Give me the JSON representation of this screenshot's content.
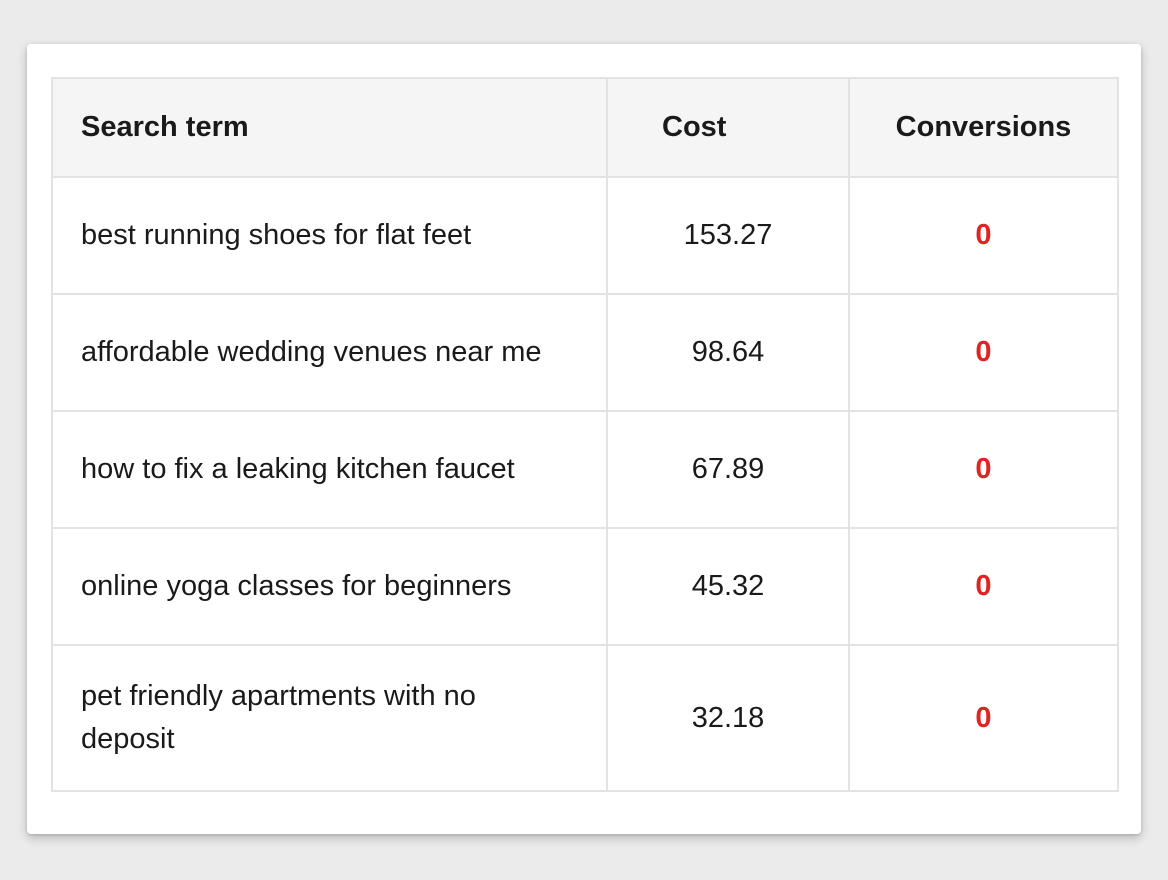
{
  "table": {
    "headers": {
      "term": "Search term",
      "cost": "Cost",
      "conversions": "Conversions"
    },
    "rows": [
      {
        "term": "best running shoes for flat feet",
        "cost": "153.27",
        "conversions": "0"
      },
      {
        "term": "affordable wedding venues near me",
        "cost": "98.64",
        "conversions": "0"
      },
      {
        "term": "how to fix a leaking kitchen faucet",
        "cost": "67.89",
        "conversions": "0"
      },
      {
        "term": "online yoga classes for beginners",
        "cost": "45.32",
        "conversions": "0"
      },
      {
        "term": "pet friendly apartments with no deposit",
        "cost": "32.18",
        "conversions": "0"
      }
    ]
  },
  "colors": {
    "page_background": "#ebebeb",
    "card_background": "#ffffff",
    "header_background": "#f5f5f5",
    "grid_line": "#e3e3e3",
    "zero_conversions": "#e02424"
  }
}
